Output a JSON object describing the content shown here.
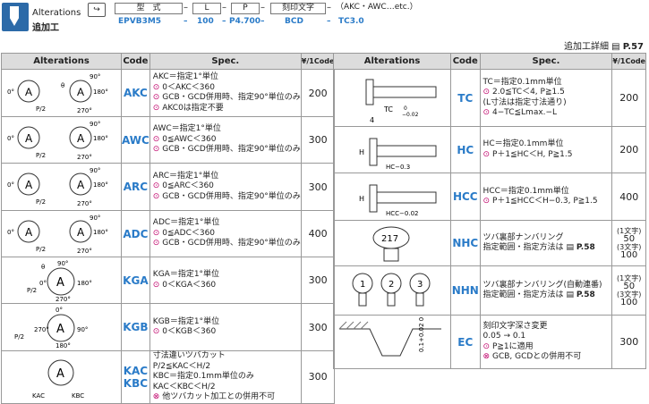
{
  "header": {
    "label_en": "Alterations",
    "label_jp": "追加工",
    "fields": [
      "型　式",
      "L",
      "P",
      "刻印文字"
    ],
    "suffix": "（AKC・AWC…etc.）",
    "values": [
      "EPVB3M5",
      "100",
      "P4.700",
      "BCD",
      "TC3.0"
    ],
    "detail_link": "追加工詳細",
    "detail_page": "P.57",
    "detail_icon": "book-icon"
  },
  "left_table": {
    "headers": [
      "Alterations",
      "Code",
      "Spec.",
      "¥/1Code"
    ],
    "rows": [
      {
        "code": "AKC",
        "price": "200",
        "spec": [
          "AKC＝指定1°単位",
          "0＜AKC＜360",
          "GCB・GCD併用時、指定90°単位のみ",
          "AKC0は指定不要"
        ]
      },
      {
        "code": "AWC",
        "price": "300",
        "spec": [
          "AWC＝指定1°単位",
          "0≦AWC＜360",
          "GCB・GCD併用時、指定90°単位のみ"
        ]
      },
      {
        "code": "ARC",
        "price": "300",
        "spec": [
          "ARC＝指定1°単位",
          "0≦ARC＜360",
          "GCB・GCD併用時、指定90°単位のみ"
        ]
      },
      {
        "code": "ADC",
        "price": "400",
        "spec": [
          "ADC＝指定1°単位",
          "0≦ADC＜360",
          "GCB・GCD併用時、指定90°単位のみ"
        ]
      },
      {
        "code": "KGA",
        "price": "300",
        "spec": [
          "KGA＝指定1°単位",
          "0＜KGA＜360"
        ]
      },
      {
        "code": "KGB",
        "price": "300",
        "spec": [
          "KGB＝指定1°単位",
          "0＜KGB＜360"
        ]
      },
      {
        "code": "KAC\nKBC",
        "price": "300",
        "spec": [
          "寸法違いツバカット",
          "P/2≦KAC＜H/2",
          "KBC＝指定0.1mm単位のみ",
          "KAC＜KBC＜H/2",
          "他ツバカット加工との併用不可"
        ]
      }
    ]
  },
  "right_table": {
    "headers": [
      "Alterations",
      "Code",
      "Spec.",
      "¥/1Code"
    ],
    "rows": [
      {
        "code": "TC",
        "price": "200",
        "spec": [
          "TC＝指定0.1mm単位",
          "2.0≦TC＜4, P≧1.5",
          "(L寸法は指定寸法通り)",
          "4−TC≦Lmax.−L"
        ]
      },
      {
        "code": "HC",
        "price": "200",
        "spec": [
          "HC＝指定0.1mm単位",
          "P＋1≦HC＜H, P≧1.5"
        ]
      },
      {
        "code": "HCC",
        "price": "400",
        "spec": [
          "HCC＝指定0.1mm単位",
          "P＋1≦HCC＜H−0.3, P≧1.5"
        ]
      },
      {
        "code": "NHC",
        "price_lines": [
          "(1文字)",
          "50",
          "(3文字)",
          "100"
        ],
        "spec": [
          "ツバ裏部ナンバリング",
          "指定範囲・指定方法は",
          "P.58"
        ],
        "sample": [
          "217"
        ]
      },
      {
        "code": "NHN",
        "price_lines": [
          "(1文字)",
          "50",
          "(3文字)",
          "100"
        ],
        "spec": [
          "ツバ裏部ナンバリング(自動連番)",
          "指定範囲・指定方法は",
          "P.58"
        ],
        "sample": [
          "1",
          "2",
          "3"
        ]
      },
      {
        "code": "EC",
        "price": "300",
        "spec": [
          "刻印文字深さ変更",
          "0.05 → 0.1",
          "P≧1に適用",
          "GCB, GCDとの併用不可"
        ],
        "dim": "0.1+0.02\n0"
      }
    ]
  },
  "colors": {
    "accent": "#2a7bc8",
    "header_bg": "#dcdcdc",
    "icon_red": "#c0006a"
  }
}
